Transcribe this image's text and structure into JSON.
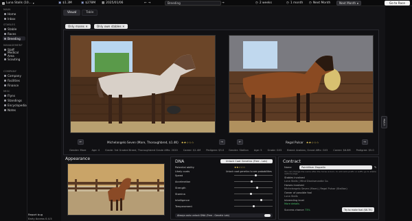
{
  "topbar": {
    "stable_name": "Luna Stalls (10...",
    "money": "$1.3M",
    "value": "$278M",
    "date": "2025/01/06",
    "search_value": "Breeding",
    "duration": "2 weeks",
    "month": "1 month",
    "next_month_1": "Next Month",
    "next_month_2": "Next Month",
    "go_to_race": "Go to Race"
  },
  "sidebar": {
    "sections": [
      {
        "title": "MAIN",
        "items": [
          "Home",
          "Inbox"
        ]
      },
      {
        "title": "STABLES",
        "items": [
          "Stable",
          "Races",
          "Breeding"
        ]
      },
      {
        "title": "MANAGEMENT",
        "items": [
          "Staff",
          "Medical Area",
          "Scouting"
        ]
      },
      {
        "title": "COMPANY",
        "items": [
          "Company",
          "Facilities",
          "Finance"
        ]
      },
      {
        "title": "MISC",
        "items": [
          "Flyns",
          "Standings",
          "Encyclopedia",
          "Notes"
        ]
      }
    ],
    "active_item": "Breeding",
    "report_bug": "Report bug",
    "early_access": "Early Access 0.4.5"
  },
  "tabs": [
    "Visual",
    "Table"
  ],
  "filters": [
    "Only mares",
    "Only own stables"
  ],
  "left_horse": {
    "name": "Michelangelo Seven (Mare, Thoroughbred, $1.4K)",
    "stars": "★★☆☆☆",
    "stats": [
      "Gender: Mare",
      "Age: 4",
      "Grade: 3rd Graded Breed, Thoroughbred Grade Affix: 2020",
      "Career: $1.4M",
      "Pedigree: $5.0"
    ]
  },
  "right_horse": {
    "name": "Regal Pulsar",
    "stars": "★★☆☆☆",
    "stats": [
      "Gender: Stallion",
      "Age: 5",
      "Grade: G03",
      "Breed: Arabian, Grand Affix: G03",
      "Career: $6.8M",
      "Pedigree: $5.0"
    ]
  },
  "side_button": "Match",
  "appearance": {
    "title": "Appearance"
  },
  "dna": {
    "title": "DNA",
    "unlock_button": "Unlock Coat Genetics (Free - Lab)",
    "potential_label": "Potential ability",
    "potential_stars": "★★☆☆☆",
    "likely_coats_label": "Likely coats",
    "likely_coats_note": "Unlock coat genetics to see probabilities",
    "rows": [
      {
        "label": "Speed",
        "level": 0.55
      },
      {
        "label": "Acceleration",
        "level": 0.45
      },
      {
        "label": "Strength",
        "level": 0.6
      },
      {
        "label": "Stamina",
        "level": 0.42
      },
      {
        "label": "Intelligence",
        "level": 0.7
      },
      {
        "label": "Temperament",
        "level": 0.5
      }
    ],
    "always_unlock": "Always auto unlock DNA (Free - Genetic Lab)"
  },
  "contract": {
    "title": "Contract",
    "name_label": "Name",
    "name_value": "Pointillism Zeppelin",
    "help_text": "You can change the name after the horse is born, to add auto prefix or suffix go to stable options page",
    "lines": [
      "Stables involved",
      "Luna Stalls | Mind Dionisenantie Co.",
      "Horses involved",
      "Michelangelo Seven (Mare) | Regal Pulsar (Stallion)",
      "Owner of possible foal",
      "Luna Stalls",
      "Inbreeding level"
    ],
    "more_details": "More details",
    "success_label": "Success chance",
    "success_value": "73%",
    "try_button": "Try to make foal ($6.7K)"
  },
  "colors": {
    "accent": "#2b5fd9",
    "success": "#4cc46a"
  }
}
